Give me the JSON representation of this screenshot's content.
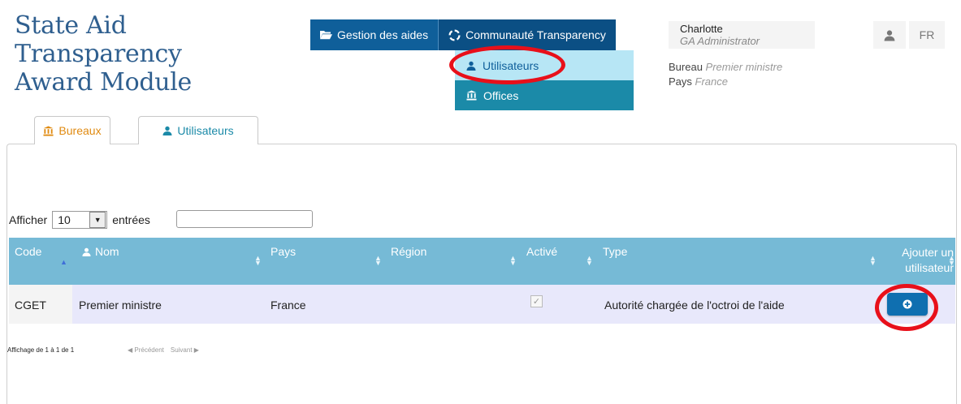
{
  "header": {
    "title_lines": [
      "State Aid",
      "Transparency",
      "Award Module"
    ]
  },
  "nav": {
    "items": [
      {
        "label": "Gestion des aides",
        "icon": "folder-open-icon"
      },
      {
        "label": "Communauté Transparency",
        "icon": "lifebuoy-icon"
      }
    ],
    "dropdown": [
      {
        "label": "Utilisateurs",
        "icon": "user-icon"
      },
      {
        "label": "Offices",
        "icon": "bank-icon"
      }
    ]
  },
  "user": {
    "name": "Charlotte",
    "role": "GA Administrator",
    "bureau_label": "Bureau",
    "bureau_value": "Premier ministre",
    "pays_label": "Pays",
    "pays_value": "France",
    "lang": "FR"
  },
  "tabs": [
    {
      "label": "Bureaux",
      "icon": "bank-icon",
      "color": "#e08a10"
    },
    {
      "label": "Utilisateurs",
      "icon": "user-icon",
      "color": "#1b8aa8"
    }
  ],
  "table_controls": {
    "show_label": "Afficher",
    "length_value": "10",
    "entries_label": "entrées",
    "search_value": ""
  },
  "table": {
    "columns": [
      "Code",
      "Nom",
      "Pays",
      "Région",
      "Activé",
      "Type",
      "Ajouter un utilisateur"
    ],
    "rows": [
      {
        "code": "CGET",
        "nom": "Premier ministre",
        "pays": "France",
        "region": "",
        "active": true,
        "type": "Autorité chargée de l'octroi de l'aide"
      }
    ]
  },
  "pagination": {
    "info": "Affichage de 1 à 1 de 1",
    "previous": "Précédent",
    "next": "Suivant"
  },
  "colors": {
    "nav_bg": "#0f5f9a",
    "dropdown_active": "#b7e6f5",
    "dropdown_item": "#1b8aa8",
    "table_header": "#76bad6",
    "annotation": "#e8101a",
    "title": "#2f5f8f"
  }
}
